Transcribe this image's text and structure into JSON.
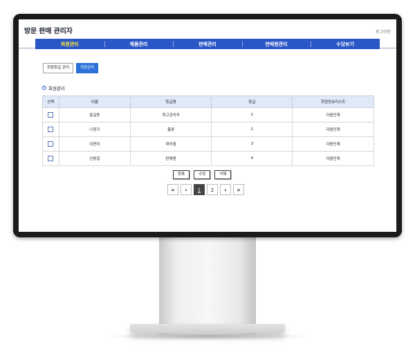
{
  "app": {
    "title": "방문 판매 관리자",
    "logout": "로그아웃"
  },
  "nav": {
    "items": [
      {
        "label": "회원관리",
        "active": true
      },
      {
        "label": "제품관리"
      },
      {
        "label": "판매관리"
      },
      {
        "label": "판매원관리"
      },
      {
        "label": "수당보기"
      }
    ]
  },
  "tabs": [
    {
      "label": "회원등급 관리",
      "active": false
    },
    {
      "label": "회원관리",
      "active": true
    }
  ],
  "section": {
    "title": "회원관리"
  },
  "table": {
    "headers": [
      "선택",
      "이름",
      "등급명",
      "등급",
      "회원정보리스트"
    ],
    "rows": [
      {
        "name": "홍길동",
        "grade_name": "최고관리자",
        "grade": "1",
        "action": "다음단계"
      },
      {
        "name": "나정기",
        "grade_name": "총판",
        "grade": "2",
        "action": "다음단계"
      },
      {
        "name": "이연자",
        "grade_name": "대리점",
        "grade": "3",
        "action": "다음단계"
      },
      {
        "name": "신동엽",
        "grade_name": "판매원",
        "grade": "4",
        "action": "다음단계"
      }
    ]
  },
  "actions": {
    "register": "등록",
    "edit": "수정",
    "delete": "삭제"
  },
  "pagination": {
    "first": "«",
    "prev": "‹",
    "pages": [
      "1",
      "2"
    ],
    "current": "1",
    "next": "›",
    "last": "»"
  },
  "colors": {
    "nav_bg": "#2a56c6",
    "nav_active_text": "#ffe93a",
    "tab_active": "#2b71d9",
    "table_header_bg": "#dfe9f7",
    "monitor_bezel": "#1b1b1d"
  }
}
